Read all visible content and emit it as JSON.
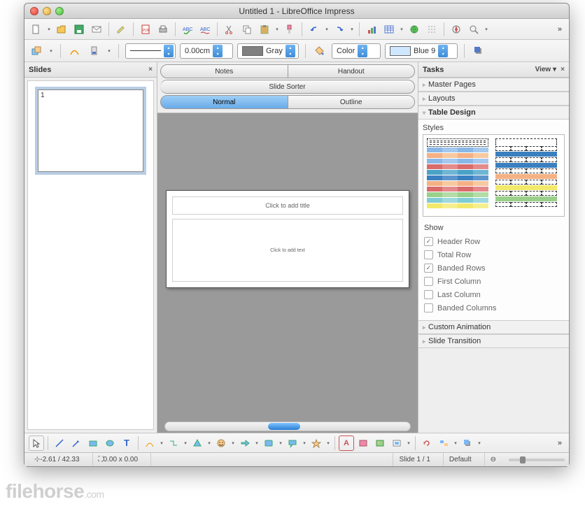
{
  "window": {
    "title": "Untitled 1 - LibreOffice Impress"
  },
  "toolbar2": {
    "line_width": "0.00cm",
    "line_color_label": "Gray",
    "fill_type": "Color",
    "fill_color_label": "Blue 9"
  },
  "slides_panel": {
    "title": "Slides",
    "slide_number": "1"
  },
  "view_tabs": {
    "notes": "Notes",
    "handout": "Handout",
    "sorter": "Slide Sorter",
    "normal": "Normal",
    "outline": "Outline"
  },
  "slide_canvas": {
    "title_placeholder": "Click to add title",
    "text_placeholder": "Click to add text"
  },
  "tasks": {
    "title": "Tasks",
    "view_label": "View",
    "sections": {
      "master_pages": "Master Pages",
      "layouts": "Layouts",
      "table_design": "Table Design",
      "custom_animation": "Custom Animation",
      "slide_transition": "Slide Transition"
    },
    "styles_label": "Styles",
    "show_label": "Show",
    "show_options": [
      {
        "label": "Header Row",
        "checked": true
      },
      {
        "label": "Total Row",
        "checked": false
      },
      {
        "label": "Banded Rows",
        "checked": true
      },
      {
        "label": "First Column",
        "checked": false
      },
      {
        "label": "Last Column",
        "checked": false
      },
      {
        "label": "Banded Columns",
        "checked": false
      }
    ]
  },
  "statusbar": {
    "cursor": "-2.61 / 42.33",
    "size": "0.00 x 0.00",
    "slide": "Slide 1 / 1",
    "layout": "Default"
  },
  "watermark": {
    "brand": "filehorse",
    "tld": ".com"
  },
  "colors": {
    "gray_swatch": "#808080",
    "blue9_swatch": "#cfe7ff"
  }
}
